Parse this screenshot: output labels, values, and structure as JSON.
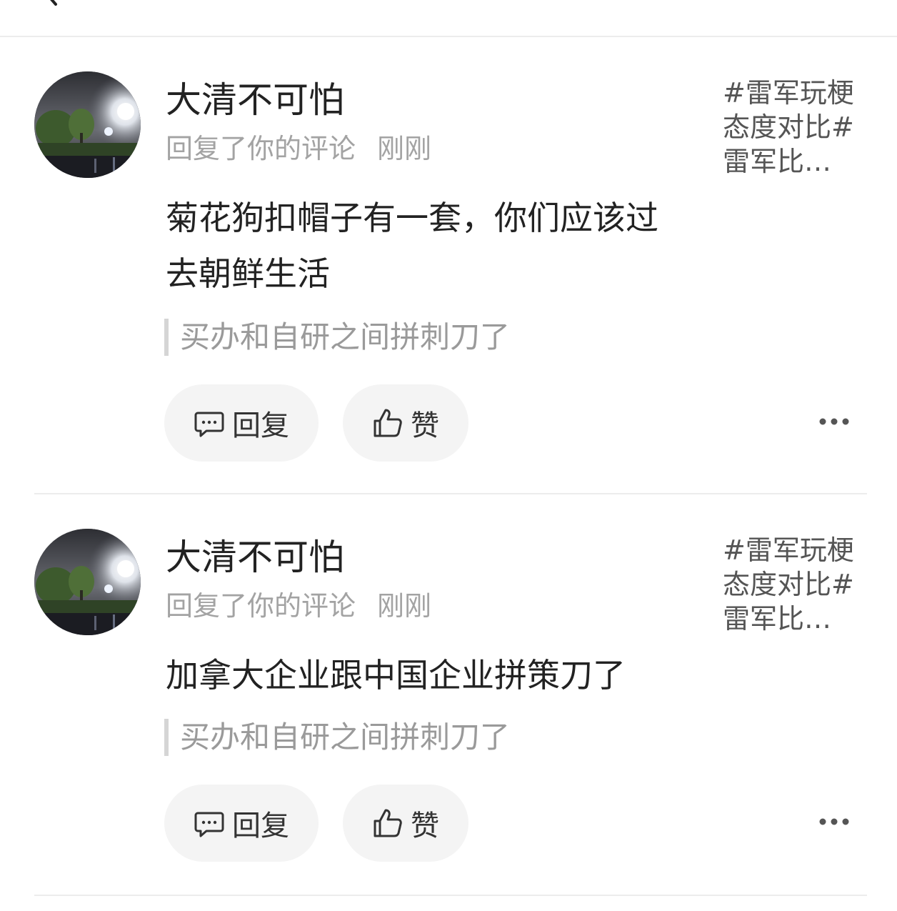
{
  "header": {
    "title": "",
    "action_label": ""
  },
  "colors": {
    "text_primary": "#222222",
    "text_secondary": "#a3a3a3",
    "button_bg": "#f4f4f4",
    "divider": "#ececec"
  },
  "notifications": [
    {
      "username": "大清不可怕",
      "action": "回复了你的评论",
      "time": "刚刚",
      "topic": "#雷军玩梗态度对比#雷军比…",
      "content": "菊花狗扣帽子有一套，你们应该过去朝鲜生活",
      "quoted_comment": "买办和自研之间拼刺刀了",
      "reply_label": "回复",
      "like_label": "赞",
      "avatar_icon": "avatar-night-street-photo"
    },
    {
      "username": "大清不可怕",
      "action": "回复了你的评论",
      "time": "刚刚",
      "topic": "#雷军玩梗态度对比#雷军比…",
      "content": "加拿大企业跟中国企业拼策刀了",
      "quoted_comment": "买办和自研之间拼刺刀了",
      "reply_label": "回复",
      "like_label": "赞",
      "avatar_icon": "avatar-night-street-photo"
    }
  ]
}
